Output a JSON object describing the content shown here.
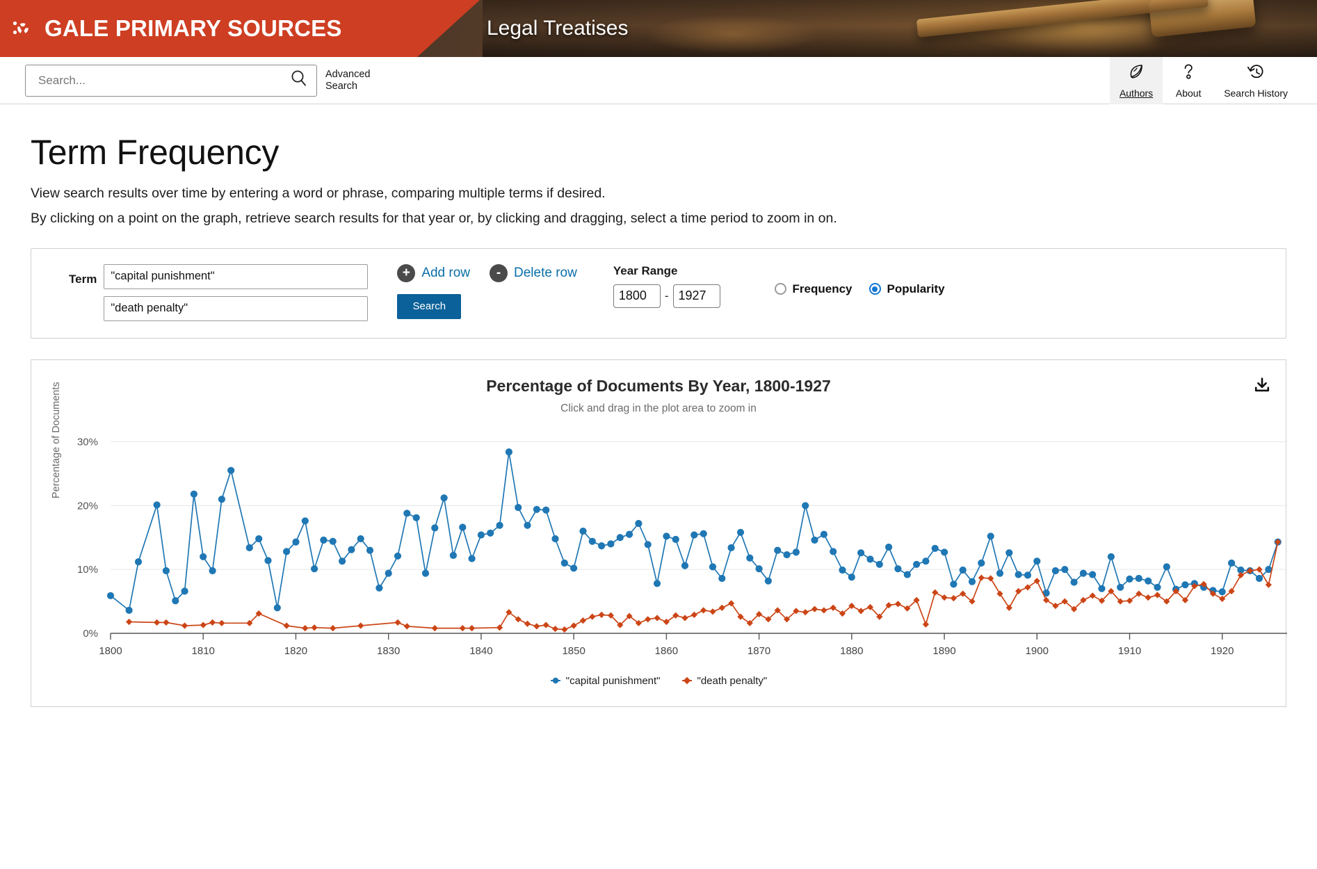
{
  "header": {
    "brand": "GALE PRIMARY SOURCES",
    "collection": "Legal Treatises",
    "brand_color": "#ce3e22",
    "logo_icon": "gale-burst-logo",
    "search_placeholder": "Search...",
    "search_value": "",
    "search_icon": "magnifier-icon",
    "advanced_search": "Advanced Search",
    "tools": [
      {
        "label": "Authors",
        "icon": "feather-icon",
        "active": true
      },
      {
        "label": "About",
        "icon": "question-mark-icon",
        "active": false
      },
      {
        "label": "Search History",
        "icon": "clock-rewind-icon",
        "active": false
      }
    ]
  },
  "page": {
    "title": "Term Frequency",
    "desc_line1": "View search results over time by entering a word or phrase, comparing multiple terms if desired.",
    "desc_line2": "By clicking on a point on the graph, retrieve search results for that year or, by clicking and dragging, select a time period to zoom in on."
  },
  "form": {
    "term_label": "Term",
    "terms": [
      "\"capital punishment\"",
      "\"death penalty\""
    ],
    "add_row": "Add row",
    "add_row_glyph": "+",
    "delete_row": "Delete row",
    "delete_row_glyph": "-",
    "search_button": "Search",
    "year_range_label": "Year Range",
    "year_from": "1800",
    "year_to": "1927",
    "year_dash": "-",
    "modes": [
      {
        "label": "Frequency",
        "selected": false
      },
      {
        "label": "Popularity",
        "selected": true
      }
    ]
  },
  "chart_panel": {
    "download_icon": "download-icon"
  },
  "chart_data": {
    "type": "line",
    "title": "Percentage of Documents By Year, 1800-1927",
    "subtitle": "Click and drag in the plot area to zoom in",
    "xlabel": "",
    "ylabel": "Percentage of Documents",
    "xlim": [
      1800,
      1927
    ],
    "ylim": [
      0,
      32
    ],
    "yticks": [
      0,
      10,
      20,
      30
    ],
    "ytick_labels": [
      "0%",
      "10%",
      "20%",
      "30%"
    ],
    "xticks": [
      1800,
      1810,
      1820,
      1830,
      1840,
      1850,
      1860,
      1870,
      1880,
      1890,
      1900,
      1910,
      1920
    ],
    "grid": "horizontal",
    "legend_position": "bottom",
    "colors": {
      "capital punishment": "#1f77b4",
      "death penalty": "#cc4516"
    },
    "markers": {
      "capital punishment": "circle",
      "death penalty": "diamond"
    },
    "series": [
      {
        "name": "\"capital punishment\"",
        "color": "#1f77b4",
        "marker": "circle",
        "points": [
          [
            1800,
            5.9
          ],
          [
            1802,
            3.6
          ],
          [
            1803,
            11.2
          ],
          [
            1805,
            20.1
          ],
          [
            1806,
            9.8
          ],
          [
            1807,
            5.1
          ],
          [
            1808,
            6.6
          ],
          [
            1809,
            21.8
          ],
          [
            1810,
            12.0
          ],
          [
            1811,
            9.8
          ],
          [
            1812,
            21.0
          ],
          [
            1813,
            25.5
          ],
          [
            1815,
            13.4
          ],
          [
            1816,
            14.8
          ],
          [
            1817,
            11.4
          ],
          [
            1818,
            4.0
          ],
          [
            1819,
            12.8
          ],
          [
            1820,
            14.3
          ],
          [
            1821,
            17.6
          ],
          [
            1822,
            10.1
          ],
          [
            1823,
            14.6
          ],
          [
            1824,
            14.4
          ],
          [
            1825,
            11.3
          ],
          [
            1826,
            13.1
          ],
          [
            1827,
            14.8
          ],
          [
            1828,
            13.0
          ],
          [
            1829,
            7.1
          ],
          [
            1830,
            9.4
          ],
          [
            1831,
            12.1
          ],
          [
            1832,
            18.8
          ],
          [
            1833,
            18.1
          ],
          [
            1834,
            9.4
          ],
          [
            1835,
            16.5
          ],
          [
            1836,
            21.2
          ],
          [
            1837,
            12.2
          ],
          [
            1838,
            16.6
          ],
          [
            1839,
            11.7
          ],
          [
            1840,
            15.4
          ],
          [
            1841,
            15.7
          ],
          [
            1842,
            16.9
          ],
          [
            1843,
            28.4
          ],
          [
            1844,
            19.7
          ],
          [
            1845,
            16.9
          ],
          [
            1846,
            19.4
          ],
          [
            1847,
            19.3
          ],
          [
            1848,
            14.8
          ],
          [
            1849,
            11.0
          ],
          [
            1850,
            10.2
          ],
          [
            1851,
            16.0
          ],
          [
            1852,
            14.4
          ],
          [
            1853,
            13.7
          ],
          [
            1854,
            14.0
          ],
          [
            1855,
            15.0
          ],
          [
            1856,
            15.5
          ],
          [
            1857,
            17.2
          ],
          [
            1858,
            13.9
          ],
          [
            1859,
            7.8
          ],
          [
            1860,
            15.2
          ],
          [
            1861,
            14.7
          ],
          [
            1862,
            10.6
          ],
          [
            1863,
            15.4
          ],
          [
            1864,
            15.6
          ],
          [
            1865,
            10.4
          ],
          [
            1866,
            8.6
          ],
          [
            1867,
            13.4
          ],
          [
            1868,
            15.8
          ],
          [
            1869,
            11.8
          ],
          [
            1870,
            10.1
          ],
          [
            1871,
            8.2
          ],
          [
            1872,
            13.0
          ],
          [
            1873,
            12.3
          ],
          [
            1874,
            12.7
          ],
          [
            1875,
            20.0
          ],
          [
            1876,
            14.6
          ],
          [
            1877,
            15.5
          ],
          [
            1878,
            12.8
          ],
          [
            1879,
            9.9
          ],
          [
            1880,
            8.8
          ],
          [
            1881,
            12.6
          ],
          [
            1882,
            11.6
          ],
          [
            1883,
            10.8
          ],
          [
            1884,
            13.5
          ],
          [
            1885,
            10.1
          ],
          [
            1886,
            9.2
          ],
          [
            1887,
            10.8
          ],
          [
            1888,
            11.3
          ],
          [
            1889,
            13.3
          ],
          [
            1890,
            12.7
          ],
          [
            1891,
            7.7
          ],
          [
            1892,
            9.9
          ],
          [
            1893,
            8.1
          ],
          [
            1894,
            11.0
          ],
          [
            1895,
            15.2
          ],
          [
            1896,
            9.4
          ],
          [
            1897,
            12.6
          ],
          [
            1898,
            9.2
          ],
          [
            1899,
            9.1
          ],
          [
            1900,
            11.3
          ],
          [
            1901,
            6.3
          ],
          [
            1902,
            9.8
          ],
          [
            1903,
            10.0
          ],
          [
            1904,
            8.0
          ],
          [
            1905,
            9.4
          ],
          [
            1906,
            9.2
          ],
          [
            1907,
            7.0
          ],
          [
            1908,
            12.0
          ],
          [
            1909,
            7.2
          ],
          [
            1910,
            8.5
          ],
          [
            1911,
            8.6
          ],
          [
            1912,
            8.2
          ],
          [
            1913,
            7.2
          ],
          [
            1914,
            10.4
          ],
          [
            1915,
            6.9
          ],
          [
            1916,
            7.6
          ],
          [
            1917,
            7.8
          ],
          [
            1918,
            7.2
          ],
          [
            1919,
            6.7
          ],
          [
            1920,
            6.5
          ],
          [
            1921,
            11.0
          ],
          [
            1922,
            9.9
          ],
          [
            1923,
            9.8
          ],
          [
            1924,
            8.6
          ],
          [
            1925,
            10.0
          ],
          [
            1926,
            14.3
          ]
        ]
      },
      {
        "name": "\"death penalty\"",
        "color": "#cc4516",
        "marker": "diamond",
        "points": [
          [
            1802,
            1.8
          ],
          [
            1805,
            1.7
          ],
          [
            1806,
            1.7
          ],
          [
            1808,
            1.2
          ],
          [
            1810,
            1.3
          ],
          [
            1811,
            1.7
          ],
          [
            1812,
            1.6
          ],
          [
            1815,
            1.6
          ],
          [
            1816,
            3.1
          ],
          [
            1819,
            1.2
          ],
          [
            1821,
            0.8
          ],
          [
            1822,
            0.9
          ],
          [
            1824,
            0.8
          ],
          [
            1827,
            1.2
          ],
          [
            1831,
            1.7
          ],
          [
            1832,
            1.1
          ],
          [
            1835,
            0.8
          ],
          [
            1838,
            0.8
          ],
          [
            1839,
            0.8
          ],
          [
            1842,
            0.9
          ],
          [
            1843,
            3.3
          ],
          [
            1844,
            2.2
          ],
          [
            1845,
            1.5
          ],
          [
            1846,
            1.1
          ],
          [
            1847,
            1.3
          ],
          [
            1848,
            0.7
          ],
          [
            1849,
            0.6
          ],
          [
            1850,
            1.2
          ],
          [
            1851,
            2.0
          ],
          [
            1852,
            2.6
          ],
          [
            1853,
            2.9
          ],
          [
            1854,
            2.8
          ],
          [
            1855,
            1.3
          ],
          [
            1856,
            2.7
          ],
          [
            1857,
            1.6
          ],
          [
            1858,
            2.2
          ],
          [
            1859,
            2.4
          ],
          [
            1860,
            1.8
          ],
          [
            1861,
            2.8
          ],
          [
            1862,
            2.4
          ],
          [
            1863,
            2.9
          ],
          [
            1864,
            3.6
          ],
          [
            1865,
            3.4
          ],
          [
            1866,
            4.0
          ],
          [
            1867,
            4.7
          ],
          [
            1868,
            2.6
          ],
          [
            1869,
            1.6
          ],
          [
            1870,
            3.0
          ],
          [
            1871,
            2.2
          ],
          [
            1872,
            3.6
          ],
          [
            1873,
            2.2
          ],
          [
            1874,
            3.5
          ],
          [
            1875,
            3.3
          ],
          [
            1876,
            3.8
          ],
          [
            1877,
            3.6
          ],
          [
            1878,
            4.0
          ],
          [
            1879,
            3.1
          ],
          [
            1880,
            4.3
          ],
          [
            1881,
            3.5
          ],
          [
            1882,
            4.1
          ],
          [
            1883,
            2.6
          ],
          [
            1884,
            4.4
          ],
          [
            1885,
            4.6
          ],
          [
            1886,
            3.9
          ],
          [
            1887,
            5.2
          ],
          [
            1888,
            1.4
          ],
          [
            1889,
            6.4
          ],
          [
            1890,
            5.6
          ],
          [
            1891,
            5.5
          ],
          [
            1892,
            6.2
          ],
          [
            1893,
            5.0
          ],
          [
            1894,
            8.7
          ],
          [
            1895,
            8.6
          ],
          [
            1896,
            6.2
          ],
          [
            1897,
            4.0
          ],
          [
            1898,
            6.6
          ],
          [
            1899,
            7.2
          ],
          [
            1900,
            8.2
          ],
          [
            1901,
            5.2
          ],
          [
            1902,
            4.3
          ],
          [
            1903,
            5.0
          ],
          [
            1904,
            3.8
          ],
          [
            1905,
            5.2
          ],
          [
            1906,
            5.9
          ],
          [
            1907,
            5.1
          ],
          [
            1908,
            6.6
          ],
          [
            1909,
            5.0
          ],
          [
            1910,
            5.1
          ],
          [
            1911,
            6.2
          ],
          [
            1912,
            5.6
          ],
          [
            1913,
            6.0
          ],
          [
            1914,
            5.0
          ],
          [
            1915,
            6.6
          ],
          [
            1916,
            5.2
          ],
          [
            1917,
            7.4
          ],
          [
            1918,
            7.7
          ],
          [
            1919,
            6.2
          ],
          [
            1920,
            5.4
          ],
          [
            1921,
            6.6
          ],
          [
            1922,
            9.1
          ],
          [
            1923,
            9.8
          ],
          [
            1924,
            10.0
          ],
          [
            1925,
            7.6
          ],
          [
            1926,
            14.3
          ]
        ]
      }
    ]
  }
}
